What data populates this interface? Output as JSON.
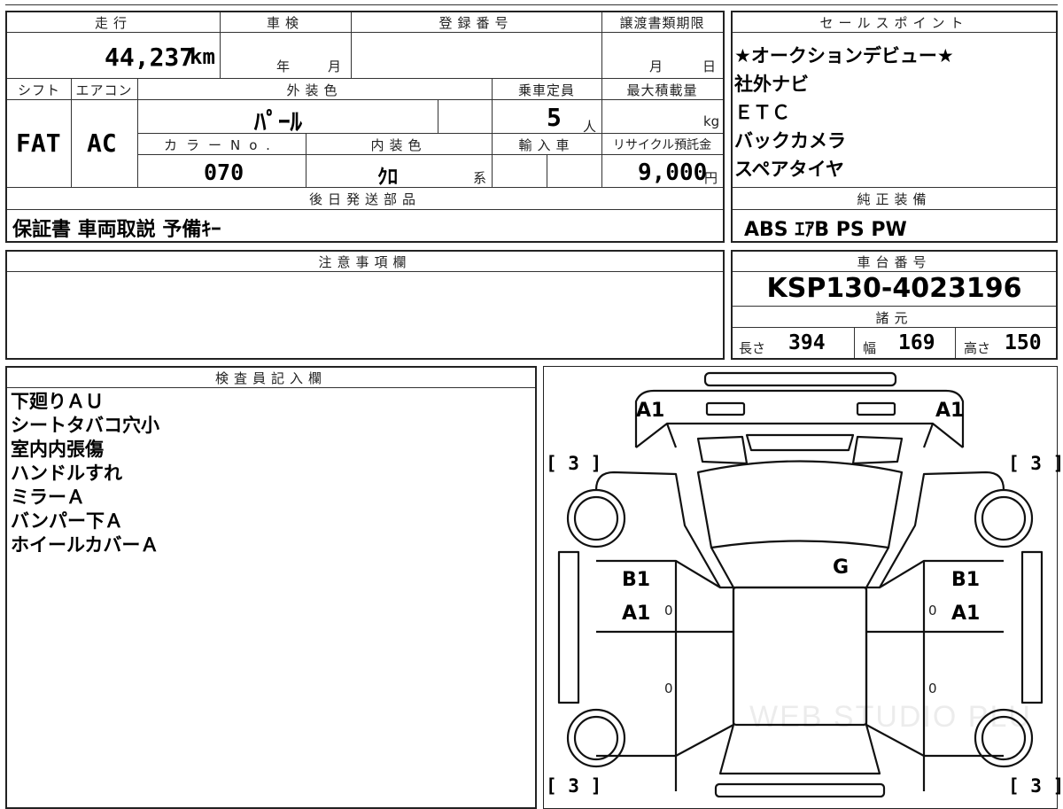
{
  "top_section": {
    "mileage": {
      "label": "走行",
      "value": "44,237",
      "unit": "km"
    },
    "shaken": {
      "label": "車検",
      "year_unit": "年",
      "month_unit": "月"
    },
    "registration_number": {
      "label": "登録番号"
    },
    "transfer_deadline": {
      "label": "譲渡書類期限",
      "month_unit": "月",
      "day_unit": "日"
    },
    "shift": {
      "label": "シフト",
      "value": "FAT"
    },
    "aircon": {
      "label": "エアコン",
      "value": "AC"
    },
    "exterior_color": {
      "label": "外装色",
      "value": "ﾊﾟｰﾙ"
    },
    "capacity": {
      "label": "乗車定員",
      "value": "5",
      "unit": "人"
    },
    "max_load": {
      "label": "最大積載量",
      "unit": "kg"
    },
    "color_no": {
      "label": "カラーNo.",
      "value": "070"
    },
    "interior_color": {
      "label": "内装色",
      "value": "ｸﾛ",
      "unit": "系"
    },
    "import": {
      "label": "輸入車"
    },
    "recycle_fee": {
      "label": "リサイクル預託金",
      "value": "9,000",
      "unit": "円"
    },
    "later_parts": {
      "label": "後日発送部品",
      "value": "保証書 車両取説 予備ｷｰ"
    }
  },
  "sales_points": {
    "label": "セールスポイント",
    "items": [
      "★オークションデビュー★",
      "社外ナビ",
      "ＥＴＣ",
      "バックカメラ",
      "スペアタイヤ"
    ]
  },
  "factory_equipment": {
    "label": "純正装備",
    "value": "ABS ｴｱB PS PW"
  },
  "notes": {
    "label": "注意事項欄"
  },
  "chassis": {
    "label": "車台番号",
    "value": "KSP130-4023196"
  },
  "specs": {
    "label": "諸元",
    "length_label": "長さ",
    "length": "394",
    "width_label": "幅",
    "width": "169",
    "height_label": "高さ",
    "height": "150"
  },
  "inspector": {
    "label": "検査員記入欄",
    "items": [
      "下廻りＡＵ",
      "シートタバコ穴小",
      "室内内張傷",
      "ハンドルすれ",
      "ミラーＡ",
      "バンパー下Ａ",
      "ホイールカバーＡ"
    ]
  },
  "diagram": {
    "front_left": "A1",
    "front_right": "A1",
    "left_top_bracket": "[ 3 ]",
    "right_top_bracket": "[ 3 ]",
    "left_bottom_bracket": "[ 3 ]",
    "right_bottom_bracket": "[ 3 ]",
    "glass": "G",
    "left_door_b": "B1",
    "left_door_a": "A1",
    "right_door_b": "B1",
    "right_door_a": "A1",
    "left_small_1": "0",
    "left_small_2": "0",
    "right_small_1": "0",
    "right_small_2": "0",
    "watermark": "WEB STUDIO PLU"
  }
}
